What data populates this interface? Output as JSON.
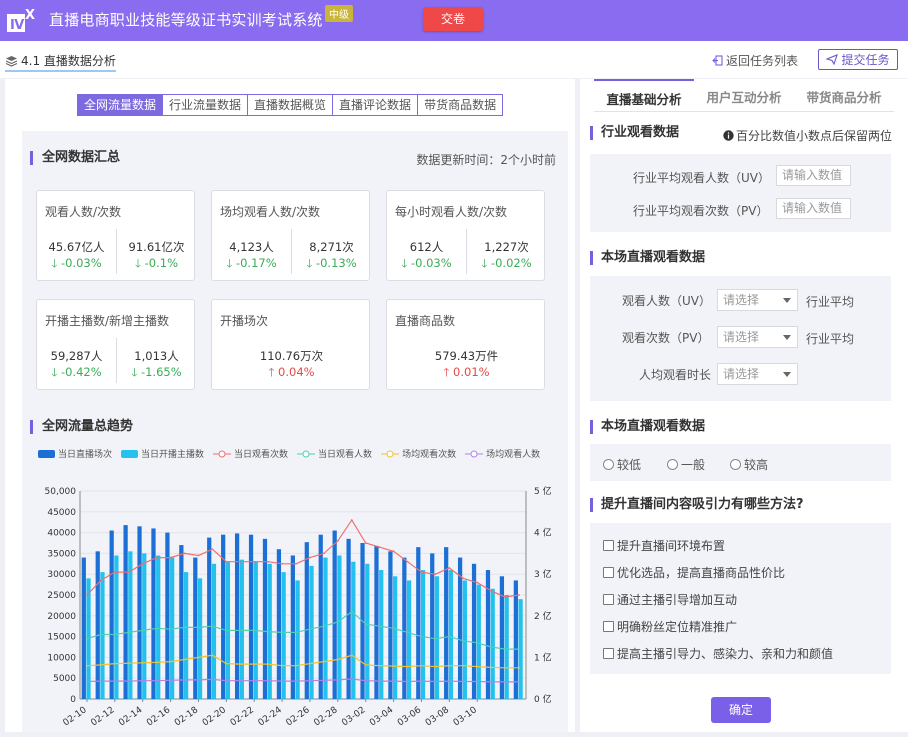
{
  "app": {
    "title": "直播电商职业技能等级证书实训考试系统",
    "level": "中级",
    "submit_exam": "交卷",
    "brand_color": "#8a6cf0"
  },
  "subbar": {
    "breadcrumb": "4.1 直播数据分析",
    "back": "返回任务列表",
    "submit_task": "提交任务"
  },
  "left": {
    "tabs": [
      "全网流量数据",
      "行业流量数据",
      "直播数据概览",
      "直播评论数据",
      "带货商品数据"
    ],
    "active_tab": 0,
    "summary_title": "全网数据汇总",
    "update_time": "数据更新时间：2个小时前",
    "cards": [
      {
        "title": "观看人数/次数",
        "values": [
          "45.67亿人",
          "91.61亿次"
        ],
        "changes": [
          "-0.03%",
          "-0.1%"
        ],
        "directions": [
          "down",
          "down"
        ]
      },
      {
        "title": "场均观看人数/次数",
        "values": [
          "4,123人",
          "8,271次"
        ],
        "changes": [
          "-0.17%",
          "-0.13%"
        ],
        "directions": [
          "down",
          "down"
        ]
      },
      {
        "title": "每小时观看人数/次数",
        "values": [
          "612人",
          "1,227次"
        ],
        "changes": [
          "-0.03%",
          "-0.02%"
        ],
        "directions": [
          "down",
          "down"
        ]
      },
      {
        "title": "开播主播数/新增主播数",
        "values": [
          "59,287人",
          "1,013人"
        ],
        "changes": [
          "-0.42%",
          "-1.65%"
        ],
        "directions": [
          "down",
          "down"
        ]
      },
      {
        "title": "开播场次",
        "values": [
          "110.76万次"
        ],
        "changes": [
          "0.04%"
        ],
        "directions": [
          "up"
        ]
      },
      {
        "title": "直播商品数",
        "values": [
          "579.43万件"
        ],
        "changes": [
          "0.01%"
        ],
        "directions": [
          "up"
        ]
      }
    ],
    "trend_title": "全网流量总趋势"
  },
  "chart_data": {
    "type": "bar",
    "legend": [
      "当日直播场次",
      "当日开播主播数",
      "当日观看次数",
      "当日观看人数",
      "场均观看次数",
      "场均观看人数"
    ],
    "colors": [
      "#1c6fd4",
      "#22c1ee",
      "#ef6f6f",
      "#4fcfb6",
      "#f1c232",
      "#b084e8"
    ],
    "x": [
      "02-10",
      "02-11",
      "02-12",
      "02-13",
      "02-14",
      "02-15",
      "02-16",
      "02-17",
      "02-18",
      "02-19",
      "02-20",
      "02-21",
      "02-22",
      "02-23",
      "02-24",
      "02-25",
      "02-26",
      "02-27",
      "02-28",
      "03-01",
      "03-02",
      "03-03",
      "03-04",
      "03-05",
      "03-06",
      "03-07",
      "03-08",
      "03-09",
      "03-10",
      "03-11",
      "03-12",
      "03-13"
    ],
    "x_ticks": [
      "02-10",
      "02-12",
      "02-14",
      "02-16",
      "02-18",
      "02-20",
      "02-22",
      "02-24",
      "02-26",
      "02-28",
      "03-02",
      "03-04",
      "03-06",
      "03-08",
      "03-10"
    ],
    "y_left_ticks": [
      "0",
      "5000",
      "10000",
      "15000",
      "20000",
      "25000",
      "30000",
      "35000",
      "40000",
      "45000",
      "50,000"
    ],
    "y_right_ticks": [
      "0 亿",
      "1 亿",
      "2 亿",
      "3 亿",
      "4 亿",
      "5 亿"
    ],
    "ylim_left": [
      0,
      50000
    ],
    "ylim_right": [
      0,
      5
    ],
    "series": [
      {
        "name": "当日直播场次",
        "axis": "left",
        "kind": "bar",
        "values": [
          34000,
          35500,
          40500,
          41800,
          41500,
          41000,
          40000,
          37000,
          34000,
          38800,
          39500,
          39800,
          39500,
          38500,
          36000,
          34500,
          37700,
          39500,
          40500,
          38500,
          37500,
          36800,
          35500,
          34000,
          36500,
          35000,
          36500,
          34000,
          32500,
          31000,
          29500,
          28500
        ]
      },
      {
        "name": "当日开播主播数",
        "axis": "left",
        "kind": "bar",
        "values": [
          29000,
          30500,
          34500,
          35500,
          35000,
          34500,
          34000,
          30500,
          29000,
          32500,
          33000,
          33500,
          33000,
          32500,
          30500,
          28500,
          32000,
          34000,
          34500,
          33000,
          32500,
          31000,
          29500,
          28500,
          31000,
          29500,
          31000,
          28500,
          27500,
          26500,
          25000,
          24000
        ]
      },
      {
        "name": "当日观看次数",
        "axis": "right",
        "kind": "line",
        "values": [
          2.5,
          2.85,
          3.05,
          3.05,
          3.25,
          3.4,
          3.4,
          3.5,
          3.45,
          3.6,
          3.3,
          3.3,
          3.3,
          3.3,
          3.25,
          3.25,
          3.4,
          3.5,
          3.8,
          4.3,
          3.75,
          3.65,
          3.55,
          3.3,
          3.05,
          3.0,
          3.15,
          2.9,
          2.8,
          2.6,
          2.45,
          2.5
        ]
      },
      {
        "name": "当日观看人数",
        "axis": "right",
        "kind": "line",
        "values": [
          1.45,
          1.55,
          1.55,
          1.6,
          1.65,
          1.7,
          1.68,
          1.72,
          1.72,
          1.75,
          1.65,
          1.65,
          1.65,
          1.62,
          1.6,
          1.6,
          1.68,
          1.75,
          1.85,
          2.1,
          1.8,
          1.75,
          1.7,
          1.6,
          1.5,
          1.45,
          1.5,
          1.4,
          1.35,
          1.25,
          1.2,
          1.2
        ]
      },
      {
        "name": "场均观看次数",
        "axis": "right",
        "kind": "line",
        "values": [
          0.8,
          0.82,
          0.85,
          0.86,
          0.87,
          0.88,
          0.9,
          0.95,
          1.0,
          1.05,
          0.85,
          0.84,
          0.84,
          0.84,
          0.8,
          0.8,
          0.85,
          0.9,
          0.95,
          1.05,
          0.82,
          0.8,
          0.79,
          0.78,
          0.8,
          0.78,
          0.8,
          0.8,
          0.78,
          0.76,
          0.75,
          0.75
        ]
      },
      {
        "name": "场均观看人数",
        "axis": "right",
        "kind": "line",
        "values": [
          0.42,
          0.43,
          0.43,
          0.43,
          0.44,
          0.44,
          0.45,
          0.46,
          0.46,
          0.47,
          0.44,
          0.44,
          0.44,
          0.44,
          0.43,
          0.43,
          0.44,
          0.45,
          0.46,
          0.48,
          0.44,
          0.43,
          0.43,
          0.42,
          0.43,
          0.42,
          0.43,
          0.42,
          0.42,
          0.41,
          0.41,
          0.41
        ]
      }
    ]
  },
  "right": {
    "tabs": [
      "直播基础分析",
      "用户互动分析",
      "带货商品分析"
    ],
    "active_tab": 0,
    "sec1": {
      "title": "行业观看数据",
      "note": "百分比数值小数点后保留两位",
      "uv_label": "行业平均观看人数（UV）",
      "pv_label": "行业平均观看次数（PV）",
      "placeholder": "请输入数值"
    },
    "sec2": {
      "title": "本场直播观看数据",
      "uv_label": "观看人数（UV）",
      "pv_label": "观看次数（PV）",
      "time_label": "人均观看时长",
      "select_placeholder": "请选择",
      "suffix": "行业平均"
    },
    "sec3": {
      "title": "本场直播观看数据",
      "options": [
        "较低",
        "一般",
        "较高"
      ]
    },
    "sec4": {
      "title": "提升直播间内容吸引力有哪些方法?",
      "options": [
        "提升直播间环境布置",
        "优化选品，提高直播商品性价比",
        "通过主播引导增加互动",
        "明确粉丝定位精准推广",
        "提高主播引导力、感染力、亲和力和颜值"
      ]
    },
    "confirm": "确定"
  }
}
